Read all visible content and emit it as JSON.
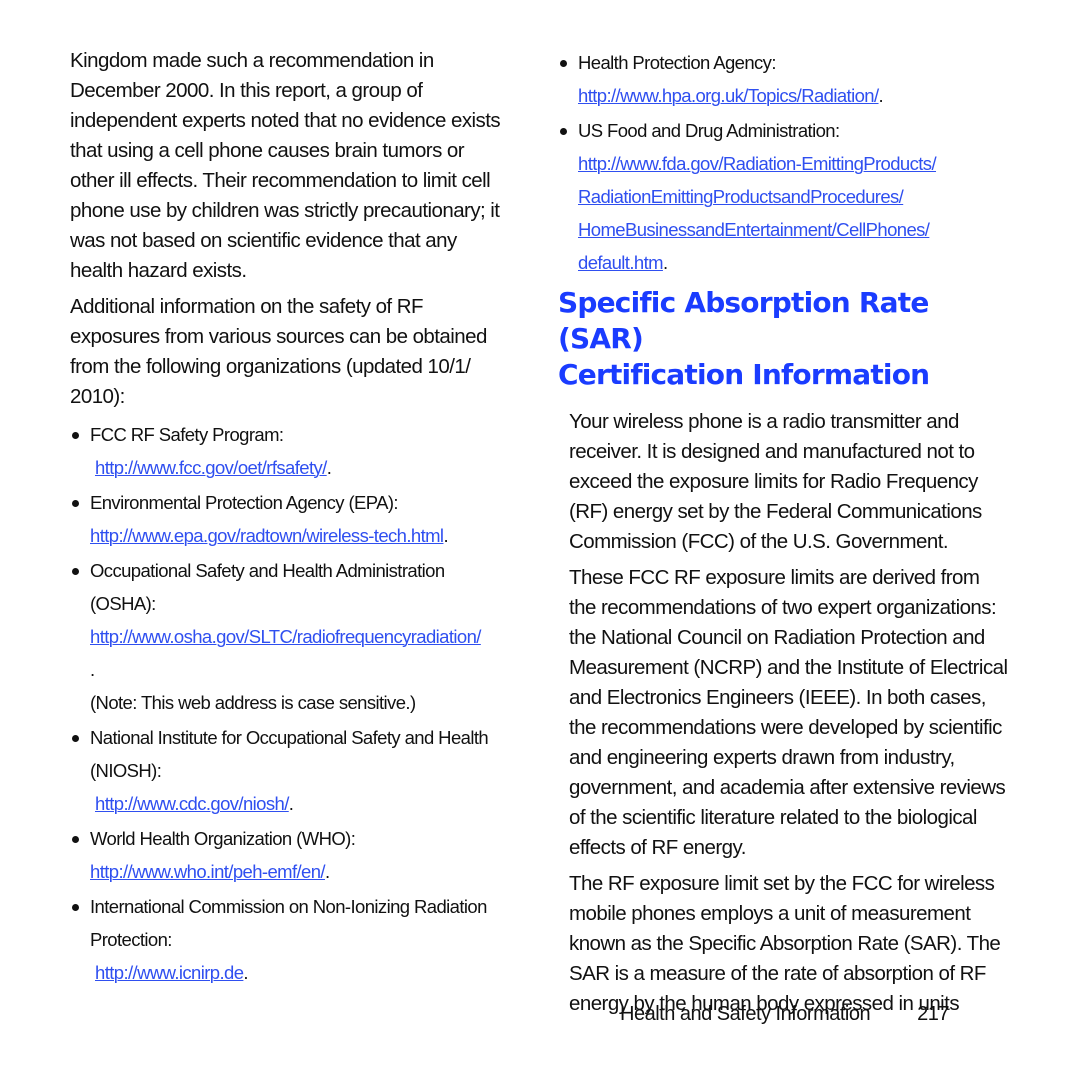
{
  "left_column": {
    "paragraph_1": "Kingdom made such a recommendation in December 2000. In this report, a group of independent experts noted that no evidence exists that using a cell phone causes brain tumors or other ill effects. Their recommendation to limit cell phone use by children was strictly precautionary; it was not based on scientific evidence that any health hazard exists.",
    "paragraph_2": "Additional information on the safety of RF exposures from various sources can be obtained from the following organizations (updated 10/1/ 2010):",
    "organizations": [
      {
        "name": "FCC RF Safety Program:",
        "url": "http://www.fcc.gov/oet/rfsafety/",
        "suffix": "."
      },
      {
        "name": "Environmental Protection Agency (EPA):",
        "url": "http://www.epa.gov/radtown/wireless-tech.html",
        "suffix": "."
      },
      {
        "name": "Occupational Safety and Health Administration (OSHA):",
        "url": "http://www.osha.gov/SLTC/radiofrequencyradiation/",
        "suffix": ".",
        "note": "(Note: This web address is case sensitive.)"
      },
      {
        "name": "National Institute for Occupational Safety and Health (NIOSH):",
        "url": "http://www.cdc.gov/niosh/",
        "suffix": "."
      },
      {
        "name": "World Health Organization (WHO):",
        "url": "http://www.who.int/peh-emf/en/",
        "suffix": "."
      },
      {
        "name": "International Commission on Non-Ionizing Radiation Protection:",
        "url": "http://www.icnirp.de",
        "suffix": "."
      }
    ]
  },
  "right_column": {
    "organizations": [
      {
        "name": "Health Protection Agency:",
        "url": "http://www.hpa.org.uk/Topics/Radiation/",
        "suffix": "."
      },
      {
        "name": "US Food and Drug Administration:",
        "url_lines": [
          "http://www.fda.gov/Radiation-EmittingProducts/",
          "RadiationEmittingProductsandProcedures/",
          "HomeBusinessandEntertainment/CellPhones/",
          "default.htm"
        ],
        "suffix": "."
      }
    ],
    "heading_line_1": "Specific Absorption Rate (SAR)",
    "heading_line_2": "Certification Information",
    "paragraph_1": "Your wireless phone is a radio transmitter and receiver. It is designed and manufactured not to exceed the exposure limits for Radio Frequency (RF) energy set by the Federal Communications Commission (FCC) of the U.S. Government.",
    "paragraph_2": "These FCC RF exposure limits are derived from the recommendations of two expert organizations: the National Council on Radiation Protection and Measurement (NCRP) and the Institute of Electrical and Electronics Engineers (IEEE). In both cases, the recommendations were developed by scientific and engineering experts drawn from industry, government, and academia after extensive reviews of the scientific literature related to the biological effects of RF energy.",
    "paragraph_3": "The RF exposure limit set by the FCC for wireless mobile phones employs a unit of measurement known as the Specific Absorption Rate (SAR). The SAR is a measure of the rate of absorption of RF energy by the human body expressed in units"
  },
  "footer": {
    "section_title": "Health and Safety Information",
    "page_number": "217"
  },
  "colors": {
    "heading": "#1a3cff",
    "link": "#2f4ff0",
    "text": "#111111"
  }
}
